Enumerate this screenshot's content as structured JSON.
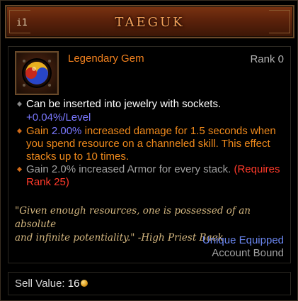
{
  "header": {
    "tag": "i1",
    "title": "TAEGUK"
  },
  "item": {
    "icon": "taeguk-gem-icon",
    "type": "Legendary Gem",
    "rank": "Rank 0"
  },
  "properties": {
    "socket_text": "Can be inserted into jewelry with sockets.",
    "per_level": "+0.04%/Level",
    "effect1_prefix": "Gain ",
    "effect1_value": "2.00%",
    "effect1_line1_rest": " increased damage for 1.5 seconds when",
    "effect1_line2": "you spend resource on a channeled skill. This effect",
    "effect1_line3": "stacks up to 10 times.",
    "effect2_text": "Gain 2.0% increased Armor for every stack.",
    "effect2_requires_a": "(Requires",
    "effect2_requires_b": "Rank 25)"
  },
  "flavor": {
    "line1": "\"Given enough resources, one is possessed of an absolute",
    "line2": "and infinite potentiality.\" -High Priest Baek"
  },
  "status": {
    "unique": "Unique Equipped",
    "bound": "Account Bound"
  },
  "sell": {
    "label": "Sell Value: ",
    "value": "16",
    "icon": "gold-coin-icon"
  },
  "colors": {
    "title": "#f3a15a",
    "legendary": "#f0801e",
    "magic_blue": "#7a78ff",
    "requirement_red": "#ff3a2a",
    "flavor_gold": "#d2b57e"
  }
}
